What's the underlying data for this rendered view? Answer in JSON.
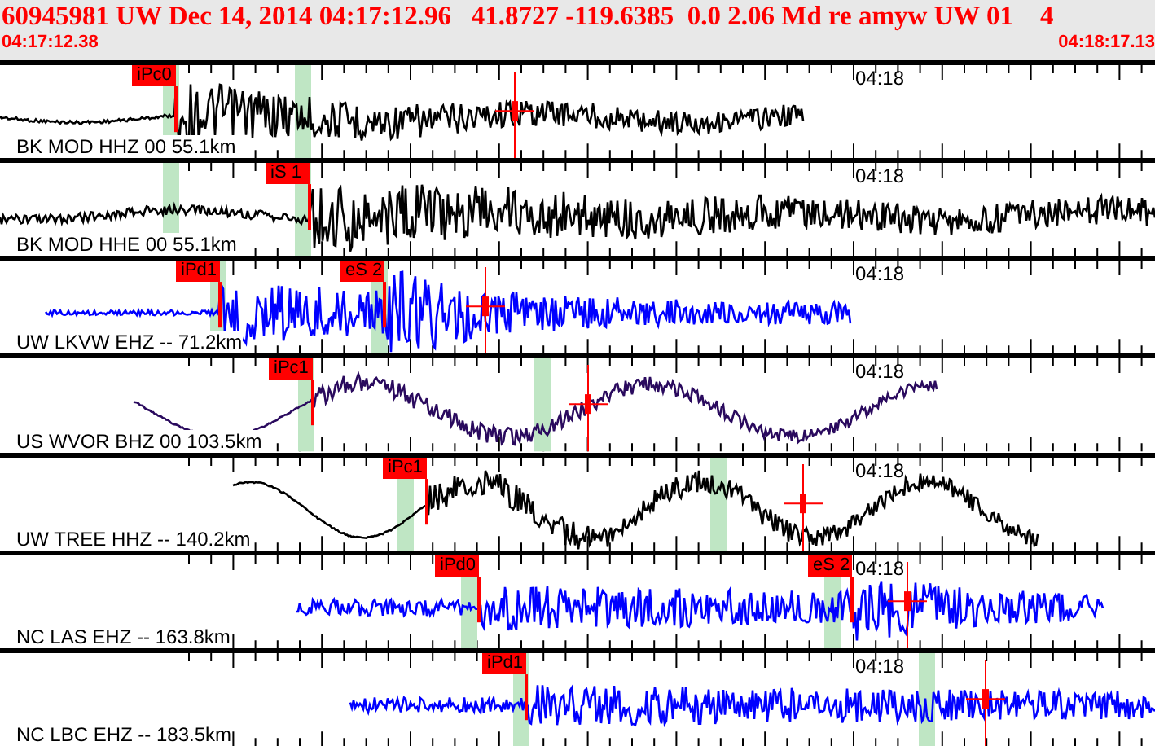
{
  "header": {
    "title": "60945981 UW Dec 14, 2014 04:17:12.96   41.8727 -119.6385  0.0 2.06 Md re amyw UW 01    4",
    "start_time": "04:17:12.38",
    "end_time": "04:18:17.13"
  },
  "traces": [
    {
      "label": "BK MOD HHZ 00 55.1km",
      "time_label": "04:18",
      "color": "#000000",
      "picks": [
        {
          "label": "iPc0"
        }
      ]
    },
    {
      "label": "BK MOD HHE 00 55.1km",
      "time_label": "04:18",
      "color": "#000000",
      "picks": [
        {
          "label": "iS 1"
        }
      ]
    },
    {
      "label": "UW LKVW EHZ -- 71.2km",
      "time_label": "04:18",
      "color": "#0000ff",
      "picks": [
        {
          "label": "iPd1"
        },
        {
          "label": "eS 2"
        }
      ]
    },
    {
      "label": "US WVOR BHZ 00 103.5km",
      "time_label": "04:18",
      "color": "#2a0a5e",
      "picks": [
        {
          "label": "iPc1"
        }
      ]
    },
    {
      "label": "UW TREE HHZ -- 140.2km",
      "time_label": "04:18",
      "color": "#000000",
      "picks": [
        {
          "label": "iPc1"
        }
      ]
    },
    {
      "label": "NC LAS EHZ -- 163.8km",
      "time_label": "04:18",
      "color": "#0000ff",
      "picks": [
        {
          "label": "iPd0"
        },
        {
          "label": "eS 2"
        }
      ]
    },
    {
      "label": "NC LBC EHZ -- 183.5km",
      "time_label": "04:18",
      "color": "#0000ff",
      "picks": [
        {
          "label": "iPd1"
        }
      ]
    }
  ]
}
